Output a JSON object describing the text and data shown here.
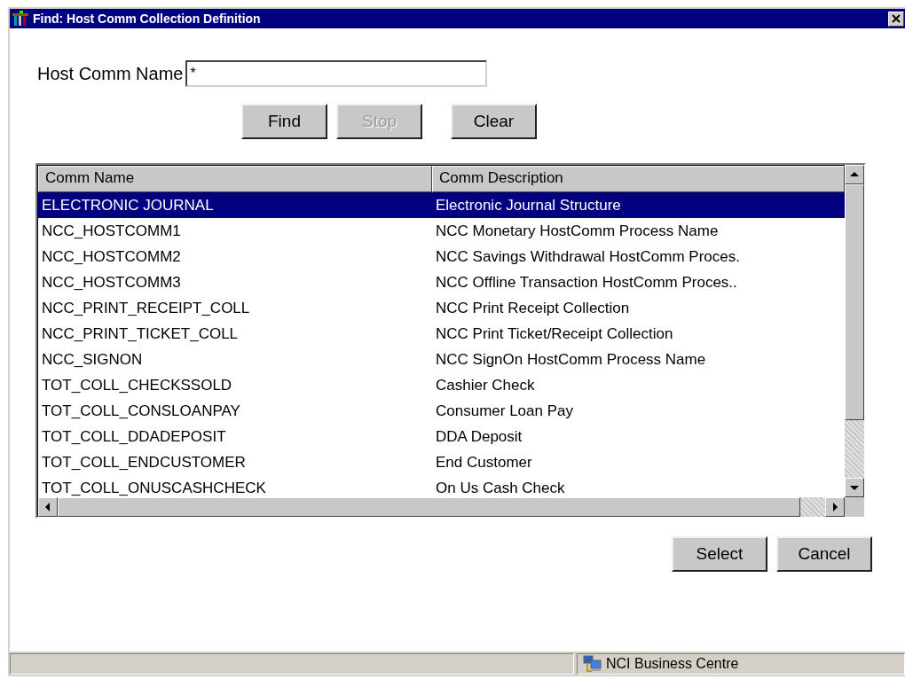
{
  "window": {
    "title": "Find: Host Comm Collection Definition"
  },
  "search": {
    "label": "Host Comm Name",
    "value": "*"
  },
  "search_buttons": [
    {
      "label": "Find",
      "disabled": false
    },
    {
      "label": "Stop",
      "disabled": true
    },
    {
      "label": "Clear",
      "disabled": false
    }
  ],
  "table": {
    "columns": [
      "Comm Name",
      "Comm Description"
    ],
    "rows": [
      {
        "name": "ELECTRONIC JOURNAL",
        "description": "Electronic Journal Structure",
        "selected": true
      },
      {
        "name": "NCC_HOSTCOMM1",
        "description": "NCC Monetary HostComm Process Name",
        "selected": false
      },
      {
        "name": "NCC_HOSTCOMM2",
        "description": "NCC Savings Withdrawal HostComm Proces.",
        "selected": false
      },
      {
        "name": "NCC_HOSTCOMM3",
        "description": "NCC Offline Transaction HostComm Proces..",
        "selected": false
      },
      {
        "name": "NCC_PRINT_RECEIPT_COLL",
        "description": "NCC Print Receipt Collection",
        "selected": false
      },
      {
        "name": "NCC_PRINT_TICKET_COLL",
        "description": "NCC Print Ticket/Receipt Collection",
        "selected": false
      },
      {
        "name": "NCC_SIGNON",
        "description": "NCC SignOn HostComm Process Name",
        "selected": false
      },
      {
        "name": "TOT_COLL_CHECKSSOLD",
        "description": "Cashier Check",
        "selected": false
      },
      {
        "name": "TOT_COLL_CONSLOANPAY",
        "description": "Consumer Loan Pay",
        "selected": false
      },
      {
        "name": "TOT_COLL_DDADEPOSIT",
        "description": "DDA Deposit",
        "selected": false
      },
      {
        "name": "TOT_COLL_ENDCUSTOMER",
        "description": "End Customer",
        "selected": false
      },
      {
        "name": "TOT_COLL_ONUSCASHCHECK",
        "description": "On Us Cash Check",
        "selected": false
      }
    ]
  },
  "dialog_buttons": [
    "Select",
    "Cancel"
  ],
  "status_bar": {
    "text": "NCI Business Centre"
  }
}
